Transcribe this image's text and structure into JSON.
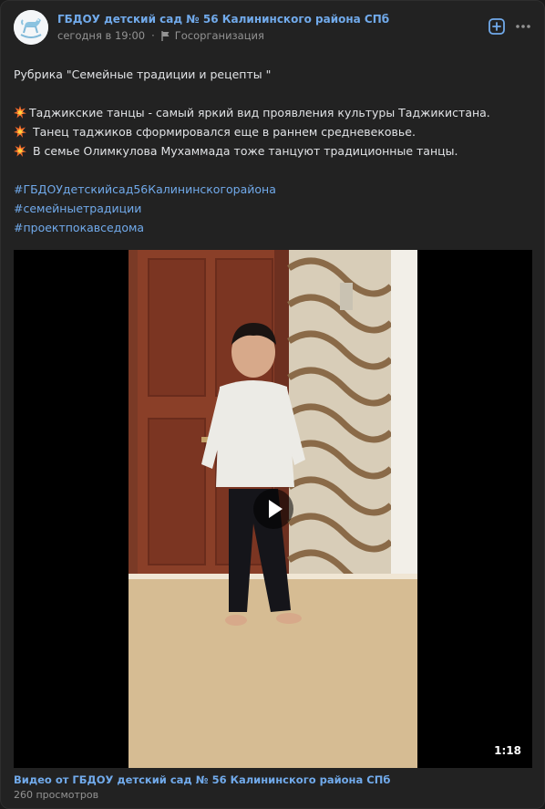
{
  "post": {
    "author": "ГБДОУ детский сад № 56 Калининского района СПб",
    "time": "сегодня в 19:00",
    "org_type": "Госорганизация",
    "avatar_icon": "rocking-horse-icon",
    "actions": {
      "add_icon": "add-square-icon",
      "more_icon": "more-dots-icon"
    }
  },
  "text": {
    "rubric": "Рубрика \"Семейные традиции и рецепты \"",
    "lines": [
      "Таджикские танцы - самый яркий вид проявления культуры Таджикистана.",
      " Танец таджиков сформировался еще в раннем средневековье.",
      " В семье Олимкулова Мухаммада тоже танцуют традиционные танцы."
    ],
    "emoji_icon": "collision-emoji-icon",
    "hashtags": [
      "#ГБДОУдетскийсад56Калининскогорайона",
      "#семейныетрадиции",
      "#проектпокавседома"
    ]
  },
  "video": {
    "duration": "1:18",
    "title": "Видео от ГБДОУ детский сад № 56 Калининского района СПб",
    "views": "260 просмотров",
    "play_icon": "play-icon"
  },
  "colors": {
    "background": "#222222",
    "link": "#71aaeb",
    "text": "#e1e3e6",
    "secondary": "#939393"
  }
}
